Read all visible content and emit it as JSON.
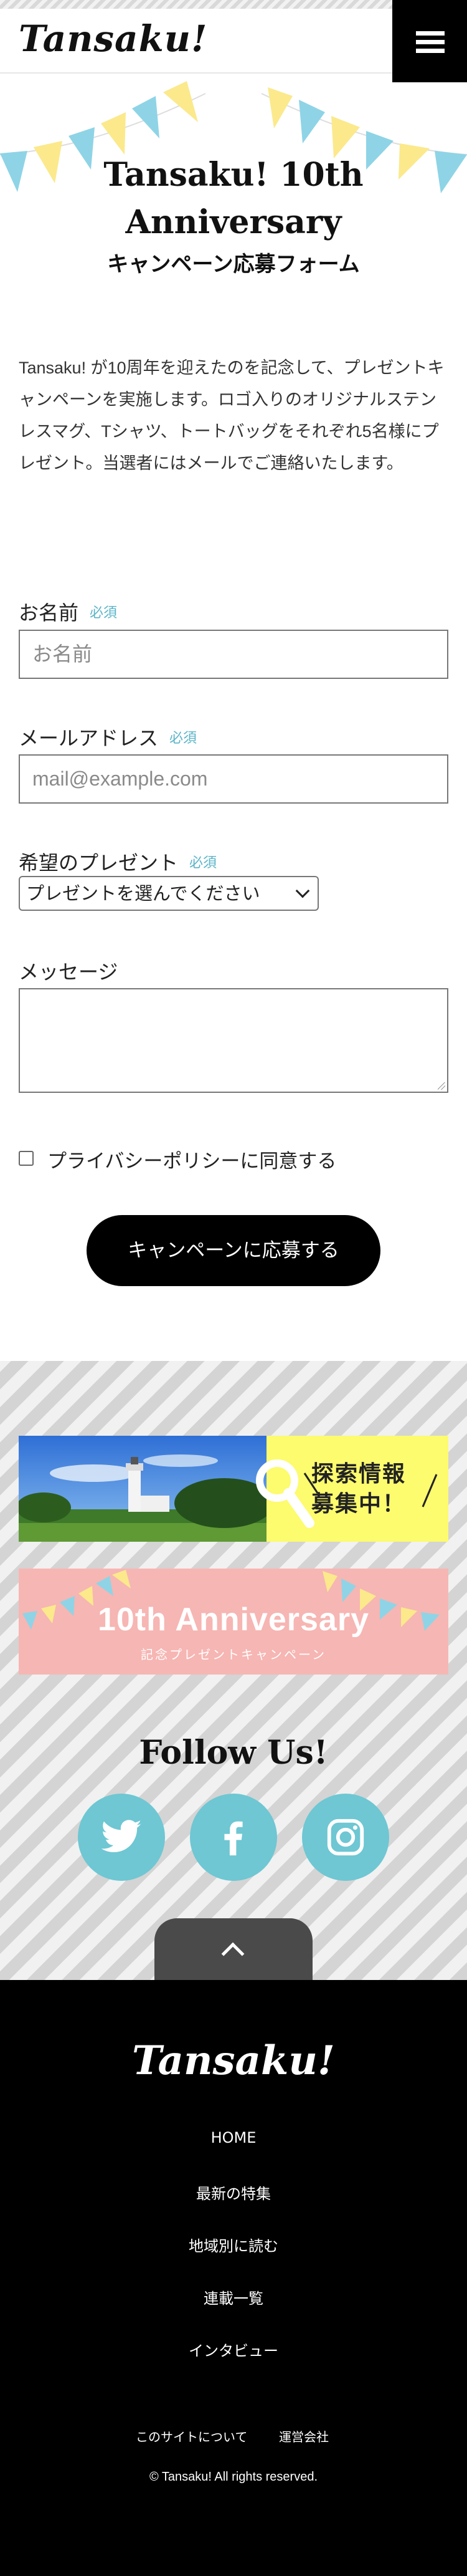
{
  "header": {
    "logo": "Tansaku!",
    "menu_icon": "hamburger-menu-icon"
  },
  "hero": {
    "title_line1": "Tansaku! 10th",
    "title_line2": "Anniversary",
    "subtitle": "キャンペーン応募フォーム",
    "bunting_colors": [
      "#8ed4e6",
      "#fbe98c"
    ]
  },
  "intro": {
    "text": "Tansaku! が10周年を迎えたのを記念して、プレゼントキャンペーンを実施します。ロゴ入りのオリジナルステンレスマグ、Tシャツ、トートバッグをそれぞれ5名様にプレゼント。当選者にはメールでご連絡いたします。"
  },
  "form": {
    "name_label": "お名前",
    "name_required": "必須",
    "name_placeholder": "お名前",
    "email_label": "メールアドレス",
    "email_required": "必須",
    "email_placeholder": "mail@example.com",
    "present_label": "希望のプレゼント",
    "present_required": "必須",
    "present_selected": "プレゼントを選んでください",
    "message_label": "メッセージ",
    "privacy_label": "プライバシーポリシーに同意する",
    "submit_label": "キャンペーンに応募する"
  },
  "promo": {
    "search_banner_line1": "探索情報",
    "search_banner_line2": "募集中！",
    "anniversary_banner_title": "10th Anniversary",
    "anniversary_banner_sub": "記念プレゼントキャンペーン",
    "follow_title": "Follow Us!",
    "social_icons": [
      "twitter-icon",
      "facebook-icon",
      "instagram-icon"
    ],
    "accent_color": "#6ec7d3"
  },
  "footer": {
    "logo": "Tansaku!",
    "nav": [
      "HOME",
      "最新の特集",
      "地域別に読む",
      "連載一覧",
      "インタビュー"
    ],
    "about": "このサイトについて",
    "company": "運営会社",
    "copyright": "© Tansaku! All rights reserved."
  }
}
